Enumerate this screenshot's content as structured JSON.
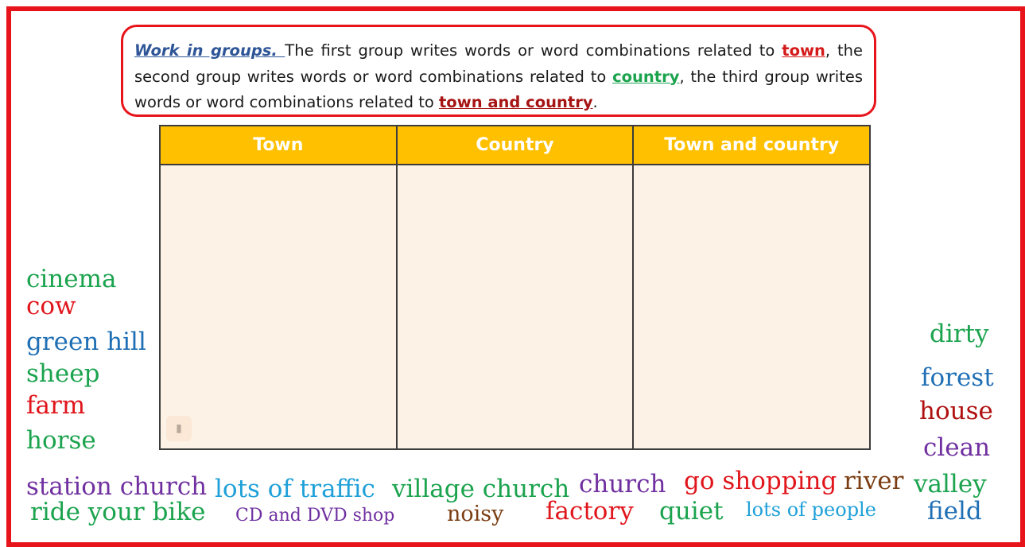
{
  "instruction": {
    "lead": "Work in groups. ",
    "p1": "The first group writes words or word combinations related to ",
    "town": "town",
    "p2": ", the second group writes words or word combinations related to ",
    "country": "country",
    "p3": ", the third group writes words or word combinations related to ",
    "both": "town and country",
    "p4": "."
  },
  "table": {
    "headers": [
      "Town",
      "Country",
      "Town and country"
    ]
  },
  "words": {
    "cinema": "cinema",
    "cow": "cow",
    "green_hill": "green hill",
    "sheep": "sheep",
    "farm": "farm",
    "horse": "horse",
    "dirty": "dirty",
    "forest": "forest",
    "house": "house",
    "clean": "clean",
    "station_church": "station church",
    "lots_of_traffic": "lots of traffic",
    "village_church": "village church",
    "church": "church",
    "go_shopping": "go shopping",
    "river": "river",
    "valley": "valley",
    "ride_your_bike": "ride your bike",
    "cd_dvd_shop": "CD and DVD shop",
    "noisy": "noisy",
    "factory": "factory",
    "quiet": "quiet",
    "lots_of_people": "lots of people",
    "field": "field"
  },
  "colors": {
    "frame": "#e8141b",
    "header": "#ffc000",
    "green": "#1ba34e",
    "red": "#e0161c",
    "blue": "#1f6fb5",
    "purple": "#7030a0",
    "brown": "#7b3d12",
    "light_blue": "#1fa0d8",
    "dark_red": "#b01010"
  }
}
